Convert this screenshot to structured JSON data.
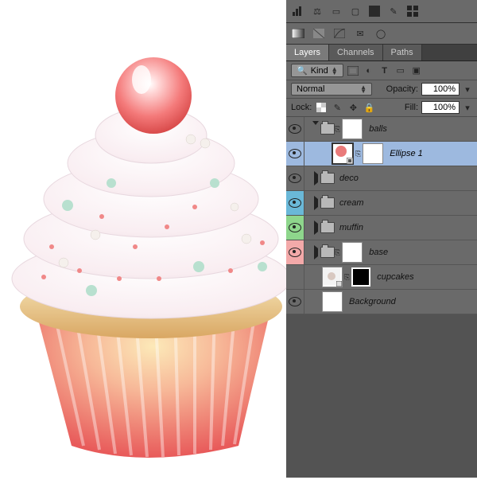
{
  "tabs": {
    "layers": "Layers",
    "channels": "Channels",
    "paths": "Paths"
  },
  "filter": {
    "kind": "Kind"
  },
  "blend": {
    "mode": "Normal",
    "opacity_label": "Opacity:",
    "opacity_value": "100%"
  },
  "lock": {
    "label": "Lock:",
    "fill_label": "Fill:",
    "fill_value": "100%"
  },
  "layers": {
    "balls": "balls",
    "ellipse": "Ellipse 1",
    "deco": "deco",
    "cream": "cream",
    "muffin": "muffin",
    "base": "base",
    "cupcakes": "cupcakes",
    "background": "Background"
  }
}
